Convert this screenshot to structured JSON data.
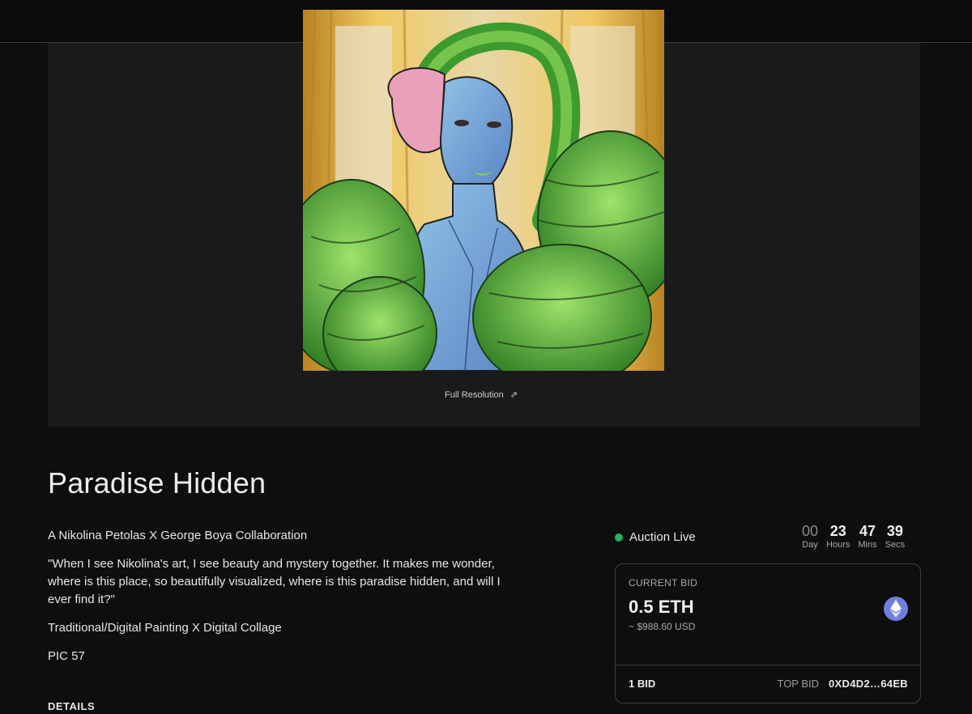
{
  "media": {
    "full_resolution_label": "Full Resolution",
    "full_resolution_icon": "arrow-up-right-icon"
  },
  "artwork": {
    "title": "Paradise Hidden",
    "description": [
      "A Nikolina Petolas X George Boya Collaboration",
      "\"When I see Nikolina's art, I see beauty and mystery together. It makes me wonder, where is this place, so beautifully visualized, where is this paradise hidden, and will I ever find it?\"",
      "Traditional/Digital Painting X Digital Collage",
      "PIC 57"
    ],
    "details_heading": "DETAILS"
  },
  "auction": {
    "status_label": "Auction Live",
    "status_color": "#1fb457",
    "countdown": [
      {
        "value": "00",
        "label": "Day"
      },
      {
        "value": "23",
        "label": "Hours"
      },
      {
        "value": "47",
        "label": "Mins"
      },
      {
        "value": "39",
        "label": "Secs"
      }
    ]
  },
  "bid": {
    "label": "CURRENT BID",
    "amount": "0.5 ETH",
    "usd": "~ $988.60 USD",
    "currency_icon": "ethereum-icon",
    "bid_count": "1 BID",
    "top_bid_label": "TOP BID",
    "top_bid_address": "0XD4D2…64EB"
  }
}
